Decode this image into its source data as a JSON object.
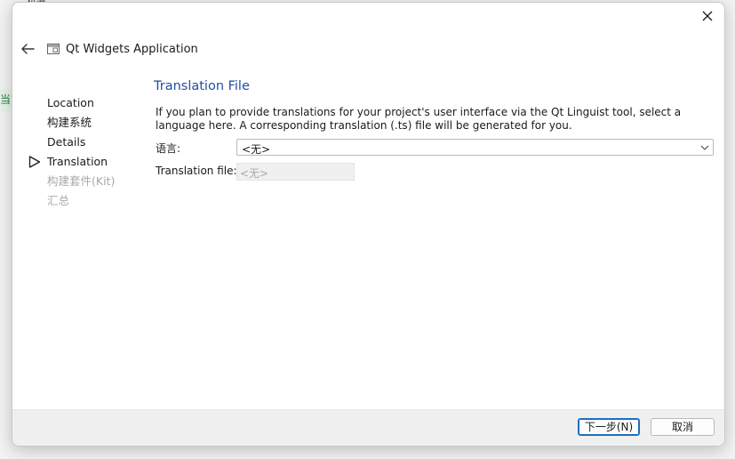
{
  "backdrop": {
    "partial_text": "当前",
    "top_text": "机器"
  },
  "window": {
    "title": "Qt Widgets Application",
    "close_label": "✕",
    "icons": {
      "back": "back-arrow-icon",
      "app": "window-icon",
      "close": "close-icon",
      "current_step": "current-step-triangle-icon",
      "dropdown": "chevron-down-icon"
    }
  },
  "sidebar": {
    "items": [
      {
        "label": "Location",
        "state": "done"
      },
      {
        "label": "构建系统",
        "state": "done"
      },
      {
        "label": "Details",
        "state": "done"
      },
      {
        "label": "Translation",
        "state": "current"
      },
      {
        "label": "构建套件(Kit)",
        "state": "pending"
      },
      {
        "label": "汇总",
        "state": "pending"
      }
    ]
  },
  "page": {
    "title": "Translation File",
    "description": "If you plan to provide translations for your project's user interface via the Qt Linguist tool, select a language here. A corresponding translation (.ts) file will be generated for you.",
    "language_label": "语言:",
    "language_value": "<无>",
    "translation_file_label": "Translation file:",
    "translation_file_value": "<无>"
  },
  "footer": {
    "next_label": "下一步(N)",
    "cancel_label": "取消"
  },
  "colors": {
    "accent_title": "#1f4fa0",
    "disabled_text": "#a8a8a8",
    "primary_button_border": "#1f6fbf"
  }
}
